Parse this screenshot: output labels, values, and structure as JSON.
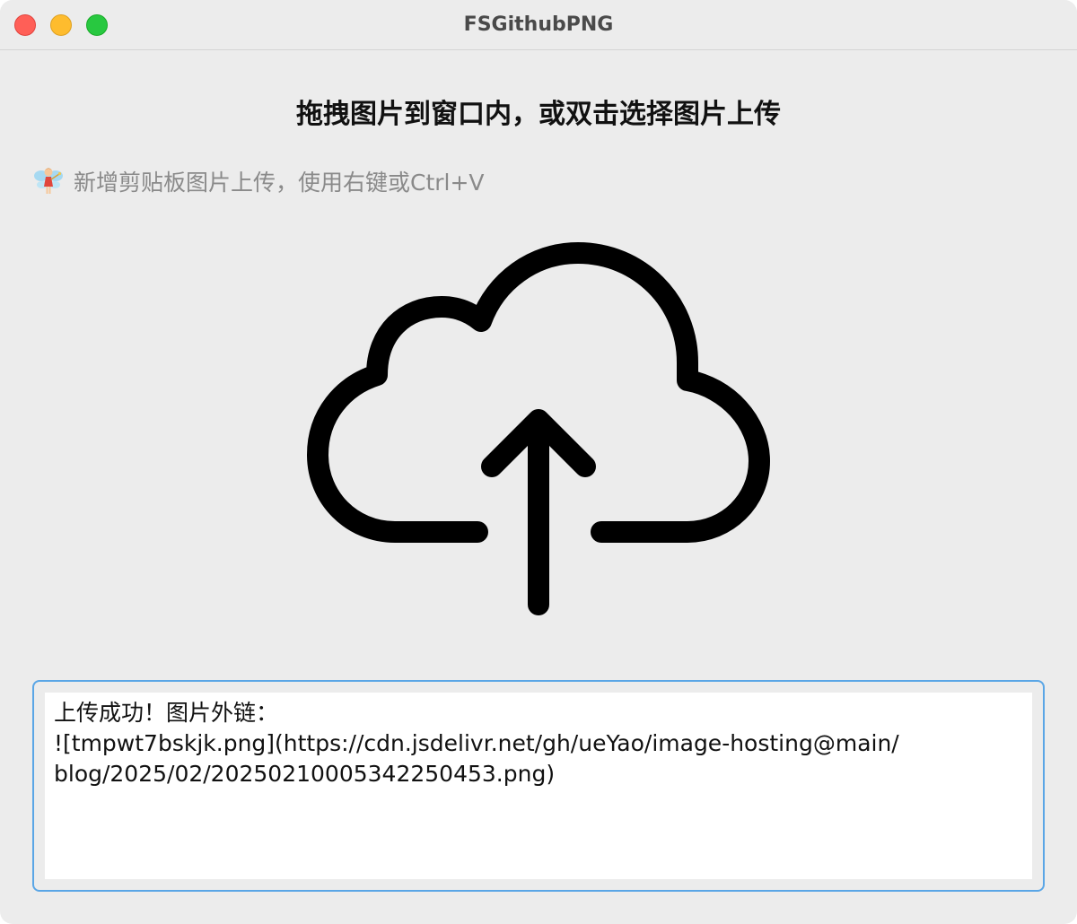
{
  "window": {
    "title": "FSGithubPNG"
  },
  "main": {
    "heading": "拖拽图片到窗口内，或双击选择图片上传",
    "hint": {
      "icon": "fairy-emoji-icon",
      "text": "新增剪贴板图片上传，使用右键或Ctrl+V"
    },
    "upload_icon": "cloud-upload-icon"
  },
  "output": {
    "text": "上传成功！图片外链：\n![tmpwt7bskjk.png](https://cdn.jsdelivr.net/gh/ueYao/image-hosting@main/\nblog/2025/02/20250210005342250453.png)"
  },
  "colors": {
    "close": "#ff5f57",
    "minimize": "#febc2e",
    "zoom": "#28c840",
    "focus_border": "#5aa6e6",
    "background": "#ececec"
  }
}
